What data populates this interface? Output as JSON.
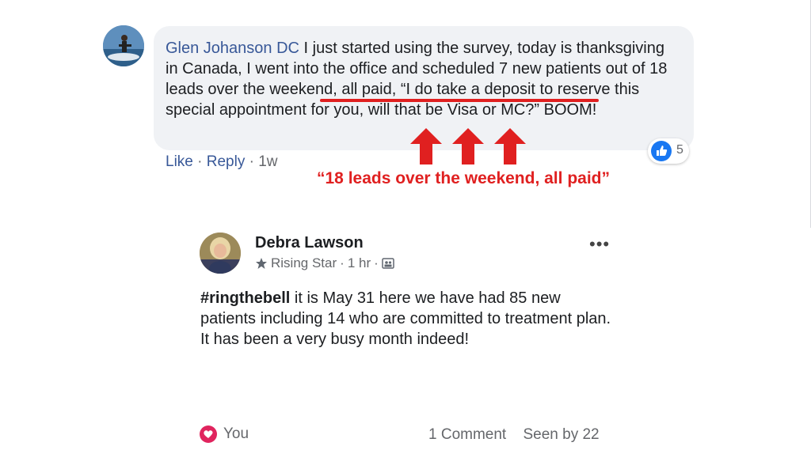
{
  "comment": {
    "author": "Glen Johanson DC",
    "text_before": " I just started using the survey, today is thanksgiving in Canada, I went into the office and scheduled 7 new patients out of ",
    "text_highlight": "18 leads over the weekend, all paid",
    "text_after": ", “I do take a deposit to reserve this special appointment for you, will that be Visa or MC?” BOOM!",
    "actions": {
      "like": "Like",
      "reply": "Reply",
      "separator": "·",
      "time": "1w"
    },
    "reaction": {
      "icon": "thumbs-up-icon",
      "count": "5"
    }
  },
  "annotation": {
    "callout": "“18 leads over the weekend, all paid”",
    "color": "#e02020"
  },
  "post": {
    "author": "Debra Lawson",
    "badge": "Rising Star",
    "meta_separator": "·",
    "time": "1 hr",
    "audience_icon": "group-icon",
    "more_label": "•••",
    "hashtag": "#ringthebell",
    "body": " it is May 31 here we have had 85 new patients including 14 who are committed to treatment plan.  It has been a very busy month indeed!",
    "footer": {
      "reaction_label": "You",
      "comments": "1 Comment",
      "seen": "Seen by 22"
    }
  },
  "colors": {
    "link": "#385898",
    "muted": "#65676b",
    "like_blue": "#1877f2",
    "heart": "#e0245e"
  }
}
